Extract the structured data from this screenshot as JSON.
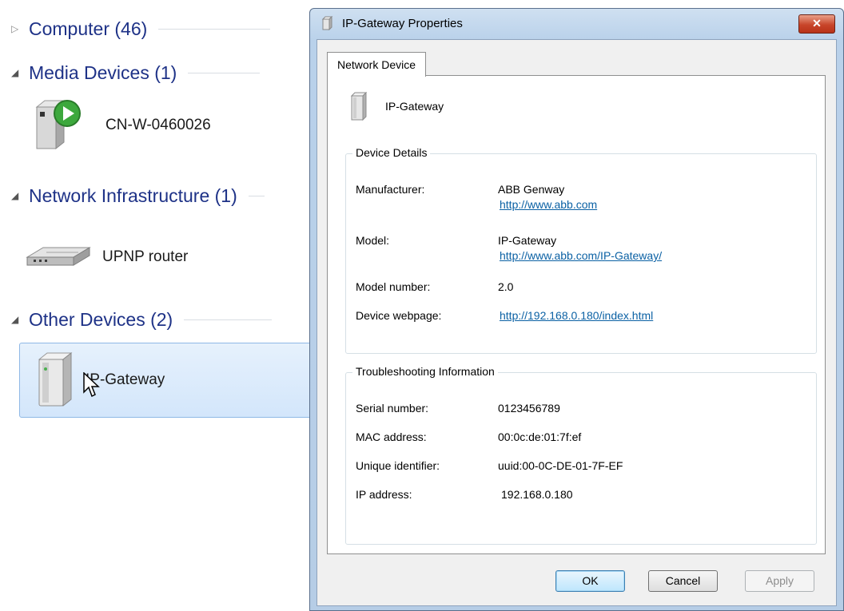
{
  "explorer": {
    "groups": [
      {
        "label": "Computer (46)",
        "expanded": false
      },
      {
        "label": "Media Devices (1)",
        "expanded": true
      },
      {
        "label": "Network Infrastructure (1)",
        "expanded": true
      },
      {
        "label": "Other Devices (2)",
        "expanded": true
      }
    ],
    "devices": {
      "media": "CN-W-0460026",
      "router": "UPNP router",
      "gateway": "IP-Gateway"
    }
  },
  "dialog": {
    "title": "IP-Gateway Properties",
    "close_label": "✕",
    "tab_label": "Network Device",
    "device_name": "IP-Gateway",
    "details": {
      "title": "Device Details",
      "manufacturer_label": "Manufacturer:",
      "manufacturer_value": "ABB Genway",
      "manufacturer_link": "http://www.abb.com",
      "model_label": "Model:",
      "model_value": "IP-Gateway",
      "model_link": "http://www.abb.com/IP-Gateway/",
      "model_number_label": "Model number:",
      "model_number_value": "2.0",
      "webpage_label": "Device webpage:",
      "webpage_value": "http://192.168.0.180/index.html"
    },
    "troubleshooting": {
      "title": "Troubleshooting Information",
      "serial_label": "Serial number:",
      "serial_value": "0123456789",
      "mac_label": "MAC address:",
      "mac_value": "00:0c:de:01:7f:ef",
      "uuid_label": "Unique identifier:",
      "uuid_value": "uuid:00-0C-DE-01-7F-EF",
      "ip_label": "IP address:",
      "ip_value": "192.168.0.180"
    },
    "buttons": {
      "ok": "OK",
      "cancel": "Cancel",
      "apply": "Apply"
    }
  },
  "colors": {
    "group_header": "#1e3287",
    "link": "#0b61a4",
    "selection": "#d3e6fb",
    "close_button": "#c8452a"
  }
}
